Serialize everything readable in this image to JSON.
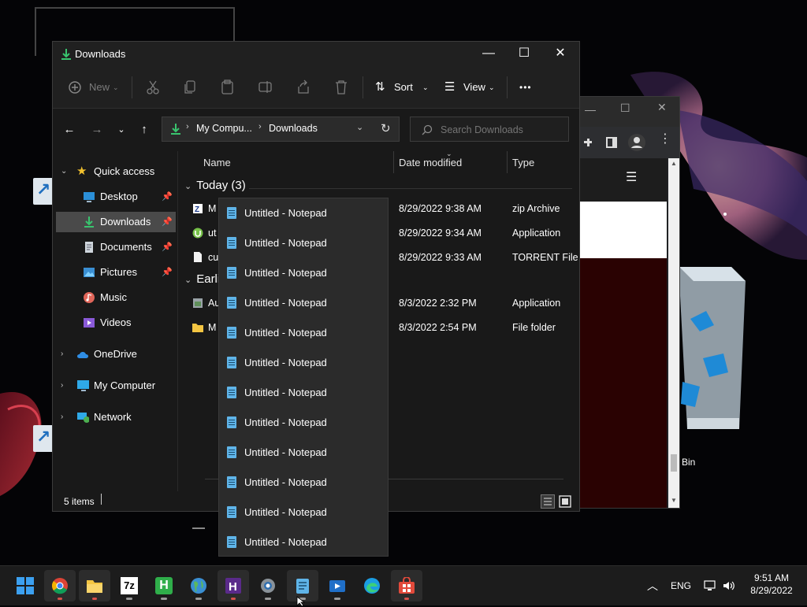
{
  "desktop": {
    "recycle_bin_label": "Bin"
  },
  "explorer": {
    "title": "Downloads",
    "window_buttons": {
      "minimize": "—",
      "maximize": "☐",
      "close": "✕"
    },
    "commands": {
      "new": "New",
      "sort": "Sort",
      "view": "View",
      "more": "•••"
    },
    "address": {
      "crumb1": "My Compu...",
      "crumb2": "Downloads",
      "search_placeholder": "Search Downloads"
    },
    "nav": {
      "quick_access": "Quick access",
      "desktop": "Desktop",
      "downloads": "Downloads",
      "documents": "Documents",
      "pictures": "Pictures",
      "music": "Music",
      "videos": "Videos",
      "onedrive": "OneDrive",
      "my_computer": "My Computer",
      "network": "Network"
    },
    "columns": {
      "name": "Name",
      "date": "Date modified",
      "type": "Type"
    },
    "groups": {
      "today": "Today (3)",
      "earlier": "Earli"
    },
    "rows": [
      {
        "name": "M",
        "date": "8/29/2022 9:38 AM",
        "type": "zip Archive"
      },
      {
        "name": "ut",
        "date": "8/29/2022 9:34 AM",
        "type": "Application"
      },
      {
        "name": "cu",
        "date": "8/29/2022 9:33 AM",
        "type": "TORRENT File"
      },
      {
        "name": "Au",
        "date": "8/3/2022 2:32 PM",
        "type": "Application"
      },
      {
        "name": "M",
        "date": "8/3/2022 2:54 PM",
        "type": "File folder"
      }
    ],
    "status": {
      "count": "5 items"
    }
  },
  "popup": {
    "items": [
      "Untitled - Notepad",
      "Untitled - Notepad",
      "Untitled - Notepad",
      "Untitled - Notepad",
      "Untitled - Notepad",
      "Untitled - Notepad",
      "Untitled - Notepad",
      "Untitled - Notepad",
      "Untitled - Notepad",
      "Untitled - Notepad",
      "Untitled - Notepad",
      "Untitled - Notepad"
    ]
  },
  "taskbar": {
    "apps": [
      "start-icon",
      "chrome-icon",
      "file-explorer-icon",
      "7zip-icon",
      "h-app-icon",
      "globe-app-icon",
      "hex-editor-icon",
      "settings-icon",
      "notepad-icon",
      "media-player-icon",
      "edge-icon",
      "store-icon"
    ],
    "seven_zip_label": "7z",
    "h_label": "H",
    "tray": {
      "lang": "ENG",
      "time": "9:51 AM",
      "date": "8/29/2022"
    }
  },
  "colors": {
    "accent": "#5fb4e8",
    "selection": "#4a4a4a",
    "window_bg": "#191919",
    "taskbar_bg": "#1c1c1c"
  }
}
